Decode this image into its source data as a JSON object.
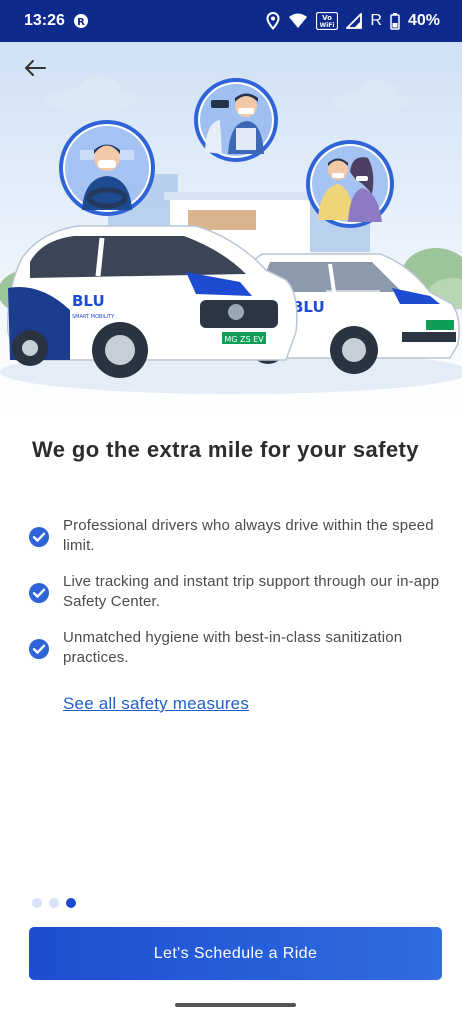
{
  "status_bar": {
    "time": "13:26",
    "battery": "40%",
    "vowifi_top": "Vo",
    "vowifi_bottom": "WiFi",
    "roaming": "R",
    "icons": [
      "app-notification-icon",
      "location-icon",
      "wifi-icon",
      "vowifi-icon",
      "signal-icon",
      "battery-icon"
    ]
  },
  "hero": {
    "back_icon": "back-arrow-icon",
    "car_brand": "BLU",
    "car_tagline": "SMART MOBILITY",
    "plate": "MG ZS EV"
  },
  "headline": "We go the extra mile for  your safety",
  "features": [
    {
      "text": "Professional drivers who always drive within the speed limit.",
      "icon": "check-circle-icon"
    },
    {
      "text": "Live tracking and instant trip support through our in-app Safety Center.",
      "icon": "check-circle-icon"
    },
    {
      "text": "Unmatched hygiene with best-in-class sanitization practices.",
      "icon": "check-circle-icon"
    }
  ],
  "link": "See all safety measures",
  "pager": {
    "total": 3,
    "active_index": 2
  },
  "cta": "Let's Schedule a Ride",
  "colors": {
    "status_bar": "#0d2a8c",
    "accent": "#1d4bd1",
    "link": "#2160c8",
    "check": "#2f63d8"
  }
}
